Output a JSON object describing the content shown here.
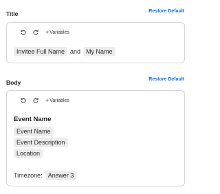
{
  "title_section": {
    "label": "Title",
    "restore_label": "Restore Default",
    "toolbar": {
      "undo_icon": "undo-icon",
      "redo_icon": "redo-icon",
      "variables_label": "Variables"
    },
    "content": {
      "chip_1": "Invitee Full Name",
      "connector": "and",
      "chip_2": "My Name"
    }
  },
  "body_section": {
    "label": "Body",
    "restore_label": "Restore Default",
    "toolbar": {
      "undo_icon": "undo-icon",
      "redo_icon": "redo-icon",
      "variables_label": "Variables"
    },
    "content": {
      "heading": "Event Name",
      "chips": [
        "Event Name",
        "Event Description",
        "Location"
      ],
      "timezone_label": "Timezone:",
      "timezone_chip": "Answer 3"
    }
  },
  "colors": {
    "accent": "#0069ff",
    "chip_bg": "#ececec",
    "border": "#d4d4d4"
  }
}
